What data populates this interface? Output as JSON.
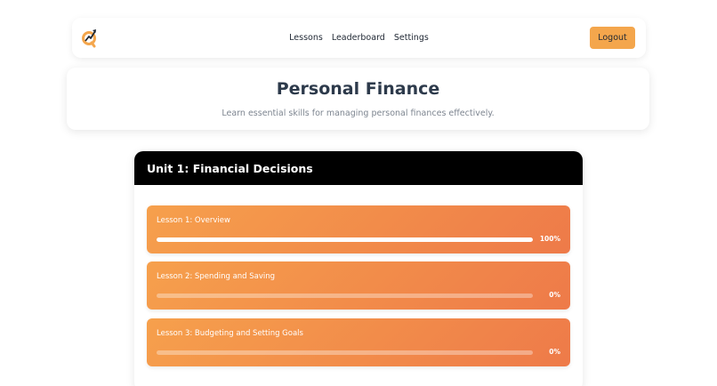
{
  "nav": {
    "items": [
      {
        "label": "Lessons"
      },
      {
        "label": "Leaderboard"
      },
      {
        "label": "Settings"
      }
    ],
    "logout_label": "Logout"
  },
  "hero": {
    "title": "Personal Finance",
    "subtitle": "Learn essential skills for managing personal finances effectively."
  },
  "unit": {
    "title": "Unit 1: Financial Decisions",
    "lessons": [
      {
        "title": "Lesson 1: Overview",
        "progress": 100,
        "progress_label": "100%"
      },
      {
        "title": "Lesson 2: Spending and Saving",
        "progress": 0,
        "progress_label": "0%"
      },
      {
        "title": "Lesson 3: Budgeting and Setting Goals",
        "progress": 0,
        "progress_label": "0%"
      }
    ]
  },
  "colors": {
    "accent": "#f4a64c",
    "lesson_gradient_start": "#f6a04c",
    "lesson_gradient_end": "#ee7a49",
    "unit_header": "#000000"
  },
  "icons": {
    "logo": "q-growth-logo-icon"
  }
}
